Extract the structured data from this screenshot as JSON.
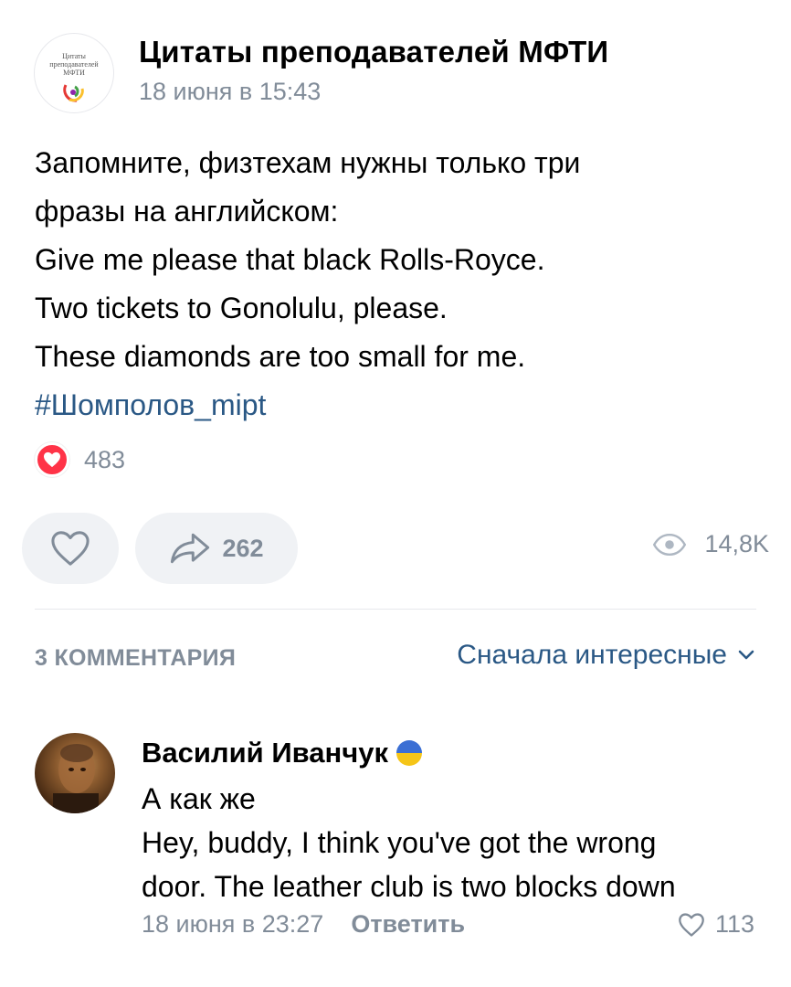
{
  "post": {
    "group_name": "Цитаты преподавателей МФТИ",
    "group_logo_lines": [
      "Цитаты",
      "преподавателей",
      "МФТИ"
    ],
    "date": "18 июня в 15:43",
    "text_lines": [
      "Запомните, физтехам нужны только три",
      "фразы на английском:",
      "Give me please that black Rolls-Royce.",
      "Two tickets to Gonolulu, please.",
      "These diamonds are too small for me."
    ],
    "hashtag": "#Шомполов_mipt",
    "reaction_count": "483",
    "share_count": "262",
    "views": "14,8K"
  },
  "comments_header": {
    "count_label": "3 КОММЕНТАРИЯ",
    "sort_label": "Сначала интересные"
  },
  "comment": {
    "author": "Василий Иванчук",
    "text_lines": [
      "А как же",
      "Hey, buddy, I think you've got the wrong",
      "door. The leather club is two blocks down"
    ],
    "date": "18 июня в 23:27",
    "reply_label": "Ответить",
    "likes": "113"
  },
  "colors": {
    "accent": "#2a5885",
    "secondary_text": "#818c99",
    "reaction_red": "#ff3347",
    "pill_bg": "#f0f2f5"
  }
}
